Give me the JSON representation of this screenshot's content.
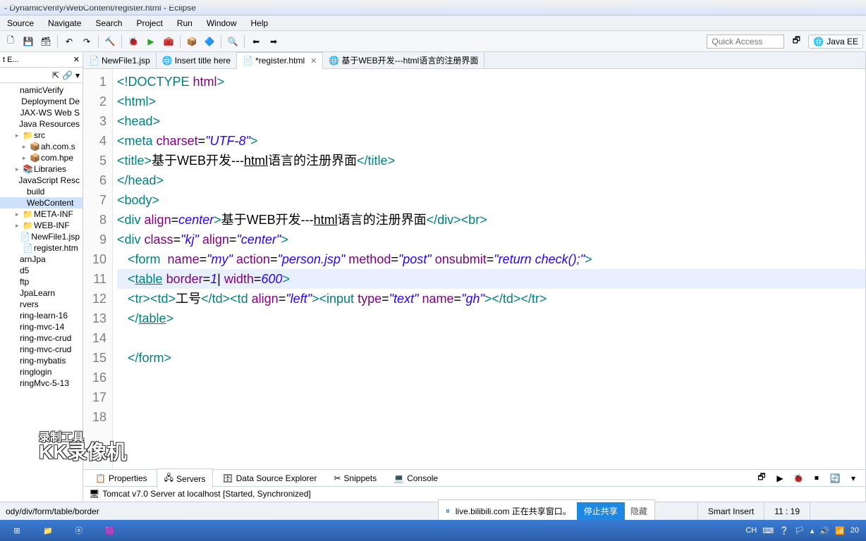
{
  "title": "- DynamicVerify/WebContent/register.html - Eclipse",
  "menu": [
    "Source",
    "Navigate",
    "Search",
    "Project",
    "Run",
    "Window",
    "Help"
  ],
  "quick_access_placeholder": "Quick Access",
  "perspective": "Java EE",
  "side_tab": "t E...",
  "tree": [
    {
      "l": "namicVerify",
      "d": 0,
      "t": ""
    },
    {
      "l": "Deployment De",
      "d": 1,
      "t": ""
    },
    {
      "l": "JAX-WS Web S",
      "d": 1,
      "t": ""
    },
    {
      "l": "Java Resources",
      "d": 1,
      "t": ""
    },
    {
      "l": "src",
      "d": 2,
      "t": "▸",
      "ico": "📁"
    },
    {
      "l": "ah.com.s",
      "d": 3,
      "t": "▸",
      "ico": "📦"
    },
    {
      "l": "com.hpe",
      "d": 3,
      "t": "▸",
      "ico": "📦"
    },
    {
      "l": "Libraries",
      "d": 2,
      "t": "▸",
      "ico": "📚"
    },
    {
      "l": "JavaScript Resc",
      "d": 1,
      "t": ""
    },
    {
      "l": "build",
      "d": 1,
      "t": ""
    },
    {
      "l": "WebContent",
      "d": 1,
      "t": "",
      "sel": true
    },
    {
      "l": "META-INF",
      "d": 2,
      "t": "▸",
      "ico": "📁"
    },
    {
      "l": "WEB-INF",
      "d": 2,
      "t": "▸",
      "ico": "📁"
    },
    {
      "l": "NewFile1.jsp",
      "d": 2,
      "t": "",
      "ico": "📄"
    },
    {
      "l": "register.htm",
      "d": 2,
      "t": "",
      "ico": "📄"
    },
    {
      "l": "arnJpa",
      "d": 0,
      "t": ""
    },
    {
      "l": "d5",
      "d": 0,
      "t": ""
    },
    {
      "l": "ftp",
      "d": 0,
      "t": ""
    },
    {
      "l": "JpaLearn",
      "d": 0,
      "t": ""
    },
    {
      "l": "rvers",
      "d": 0,
      "t": ""
    },
    {
      "l": "ring-learn-16",
      "d": 0,
      "t": ""
    },
    {
      "l": "ring-mvc-14",
      "d": 0,
      "t": ""
    },
    {
      "l": "ring-mvc-crud",
      "d": 0,
      "t": ""
    },
    {
      "l": "ring-mvc-crud",
      "d": 0,
      "t": ""
    },
    {
      "l": "ring-mybatis",
      "d": 0,
      "t": ""
    },
    {
      "l": "ringlogin",
      "d": 0,
      "t": ""
    },
    {
      "l": "ringMvc-5-13",
      "d": 0,
      "t": ""
    }
  ],
  "editor_tabs": [
    {
      "label": "NewFile1.jsp",
      "ico": "📄"
    },
    {
      "label": "Insert title here",
      "ico": "🌐"
    },
    {
      "label": "*register.html",
      "ico": "📄",
      "active": true,
      "close": true
    },
    {
      "label": "基于WEB开发---html语言的注册界面",
      "ico": "🌐"
    }
  ],
  "code_lines": [
    {
      "n": 1,
      "html": "<span class='tag'>&lt;!DOCTYPE</span> <span class='attr'>html</span><span class='tag'>&gt;</span>"
    },
    {
      "n": 2,
      "html": "<span class='tag'>&lt;html&gt;</span>",
      "fold": true
    },
    {
      "n": 3,
      "html": "<span class='tag'>&lt;head&gt;</span>",
      "fold": true
    },
    {
      "n": 4,
      "html": "<span class='tag'>&lt;meta</span> <span class='attr'>charset</span>=<span class='val'>\"UTF-8\"</span><span class='tag'>&gt;</span>"
    },
    {
      "n": 5,
      "html": "<span class='tag'>&lt;title&gt;</span><span class='text'>基于WEB开发---<u>html</u>语言的注册界面</span><span class='tag'>&lt;/title&gt;</span>"
    },
    {
      "n": 6,
      "html": "<span class='tag'>&lt;/head&gt;</span>"
    },
    {
      "n": 7,
      "html": "<span class='tag'>&lt;body&gt;</span>",
      "fold": true
    },
    {
      "n": 8,
      "html": "<span class='tag'>&lt;div</span> <span class='attr'>align</span>=<span class='val'>center</span><span class='tag'>&gt;</span><span class='text'>基于WEB开发---<u>html</u>语言的注册界面</span><span class='tag'>&lt;/div&gt;&lt;br&gt;</span>"
    },
    {
      "n": 9,
      "html": "<span class='tag'>&lt;div</span> <span class='attr'>class</span>=<span class='val'>\"kj\"</span> <span class='attr'>align</span>=<span class='val'>\"center\"</span><span class='tag'>&gt;</span>",
      "fold": true
    },
    {
      "n": 10,
      "html": "   <span class='tag'>&lt;form</span>  <span class='attr'>name</span>=<span class='val'>\"my\"</span> <span class='attr'>action</span>=<span class='val'>\"person.jsp\"</span> <span class='attr'>method</span>=<span class='val'>\"post\"</span> <span class='attr'>onsubmit</span>=<span class='val'>\"return check();\"</span><span class='tag'>&gt;</span>"
    },
    {
      "n": 11,
      "html": "   <span class='tag'>&lt;<u>table</u></span> <span class='attr'>border</span>=<span class='val'>1</span><span class='text'>|</span> <span class='attr'>width</span>=<span class='val'>600</span><span class='tag'>&gt;</span>",
      "current": true,
      "fold": true
    },
    {
      "n": 12,
      "html": "   <span class='tag'>&lt;tr&gt;&lt;td&gt;</span><span class='text'>工号</span><span class='tag'>&lt;/td&gt;&lt;td</span> <span class='attr'>align</span>=<span class='val'>\"left\"</span><span class='tag'>&gt;&lt;input</span> <span class='attr'>type</span>=<span class='val'>\"text\"</span> <span class='attr'>name</span>=<span class='val'>\"gh\"</span><span class='tag'>&gt;&lt;/td&gt;&lt;/tr&gt;</span>"
    },
    {
      "n": 13,
      "html": "   <span class='tag'>&lt;/<u>table</u>&gt;</span>"
    },
    {
      "n": 14,
      "html": ""
    },
    {
      "n": 15,
      "html": "   <span class='tag'>&lt;/form&gt;</span>"
    },
    {
      "n": 16,
      "html": ""
    },
    {
      "n": 17,
      "html": ""
    },
    {
      "n": 18,
      "html": ""
    }
  ],
  "bottom_tabs": [
    {
      "label": "Properties",
      "ico": "📋"
    },
    {
      "label": "Servers",
      "ico": "🖧",
      "active": true
    },
    {
      "label": "Data Source Explorer",
      "ico": "🗄"
    },
    {
      "label": "Snippets",
      "ico": "✂"
    },
    {
      "label": "Console",
      "ico": "💻"
    }
  ],
  "server_line": "Tomcat v7.0 Server at localhost  [Started, Synchronized]",
  "status_path": "ody/div/form/table/border",
  "share_text": "live.bilibili.com 正在共享窗口。",
  "share_stop": "停止共享",
  "share_hide": "隐藏",
  "status_insert": "Smart Insert",
  "status_pos": "11 : 19",
  "tray_text": "CH",
  "tray_time": "20",
  "watermark_top": "录制工具",
  "watermark_main": "KK录像机"
}
